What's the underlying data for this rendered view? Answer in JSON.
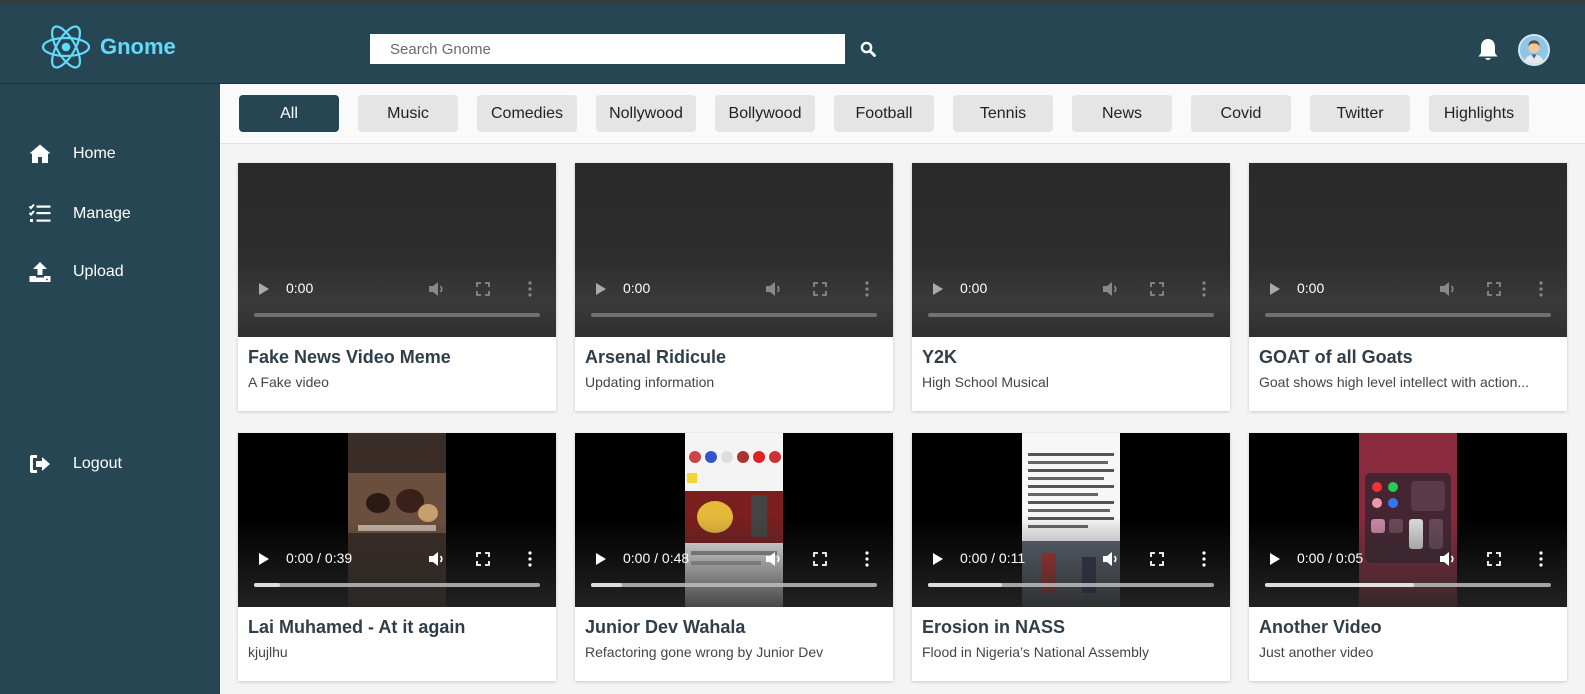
{
  "app": {
    "name": "Gnome"
  },
  "search": {
    "placeholder": "Search Gnome"
  },
  "sidebar": {
    "items": [
      {
        "label": "Home",
        "icon": "home-icon"
      },
      {
        "label": "Manage",
        "icon": "list-check-icon"
      },
      {
        "label": "Upload",
        "icon": "upload-icon"
      }
    ],
    "logout": {
      "label": "Logout",
      "icon": "sign-out-icon"
    }
  },
  "chips": [
    "All",
    "Music",
    "Comedies",
    "Nollywood",
    "Bollywood",
    "Football",
    "Tennis",
    "News",
    "Covid",
    "Twitter",
    "Highlights"
  ],
  "active_chip": "All",
  "colors": {
    "primary": "#264653",
    "brand_accent": "#61dafb"
  },
  "videos": [
    {
      "title": "Fake News Video Meme",
      "description": "A Fake video",
      "time": "0:00",
      "progress": 0
    },
    {
      "title": "Arsenal Ridicule",
      "description": "Updating information",
      "time": "0:00",
      "progress": 0
    },
    {
      "title": "Y2K",
      "description": "High School Musical",
      "time": "0:00",
      "progress": 0
    },
    {
      "title": "GOAT of all Goats",
      "description": "Goat shows high level intellect with action...",
      "time": "0:00",
      "progress": 0
    },
    {
      "title": "Lai Muhamed - At it again",
      "description": "kjujlhu",
      "time": "0:00 / 0:39",
      "progress": 0.09
    },
    {
      "title": "Junior Dev Wahala",
      "description": "Refactoring gone wrong by Junior Dev",
      "time": "0:00 / 0:48",
      "progress": 0.11
    },
    {
      "title": "Erosion in NASS",
      "description": "Flood in Nigeria’s National Assembly",
      "time": "0:00 / 0:11",
      "progress": 0.26
    },
    {
      "title": "Another Video",
      "description": "Just another video",
      "time": "0:00 / 0:05",
      "progress": 0.52
    }
  ]
}
